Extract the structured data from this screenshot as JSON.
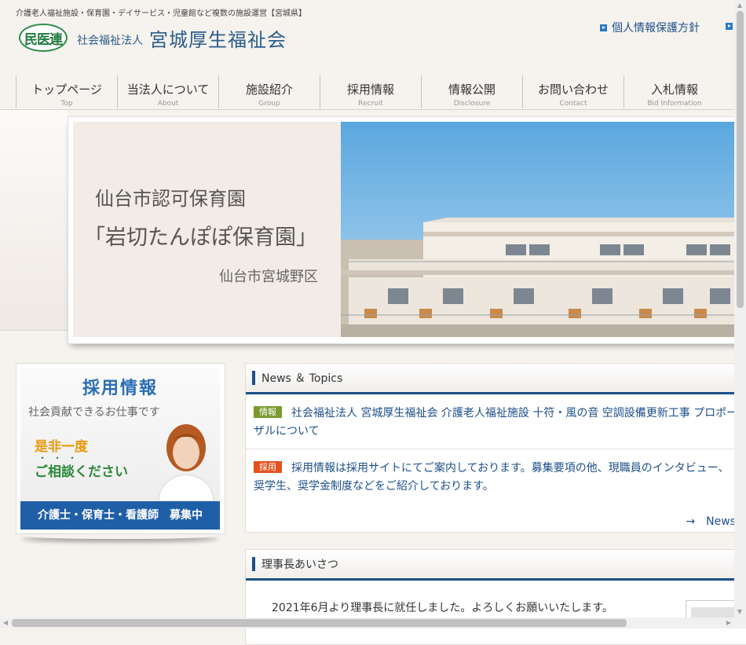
{
  "header": {
    "tagline": "介護老人福祉施設・保育園・デイサービス・児童館など複数の施設運営【宮城県】",
    "logo_mark": "民医連",
    "org_type": "社会福祉法人",
    "org_name": "宮城厚生福祉会",
    "privacy_link": "個人情報保護方針"
  },
  "nav": [
    {
      "label": "トップページ",
      "sub": "Top"
    },
    {
      "label": "当法人について",
      "sub": "About"
    },
    {
      "label": "施設紹介",
      "sub": "Group"
    },
    {
      "label": "採用情報",
      "sub": "Recruit"
    },
    {
      "label": "情報公開",
      "sub": "Disclosure"
    },
    {
      "label": "お問い合わせ",
      "sub": "Contact"
    },
    {
      "label": "入札情報",
      "sub": "Bid Information"
    }
  ],
  "hero": {
    "line1": "仙台市認可保育園",
    "line2": "「岩切たんぽぽ保育園」",
    "line3": "仙台市宮城野区"
  },
  "recruit_banner": {
    "title": "採用情報",
    "subtitle": "社会貢献できるお仕事です",
    "line1": "是非一度",
    "dots": "・・・",
    "line2": "ご相談ください",
    "banner": "介護士・保育士・看護師　募集中"
  },
  "news": {
    "title": "News ＆ Topics",
    "items": [
      {
        "badge": "情報",
        "badge_color": "#7a9a2e",
        "text": "社会福祉法人 宮城厚生福祉会 介護老人福祉施設 十符・風の音 空調設備更新工事 プロポーザルについて"
      },
      {
        "badge": "採用",
        "badge_color": "#e0531f",
        "text": "採用情報は採用サイトにてご案内しております。募集要項の他、現職員のインタビュー、奨学生、奨学金制度などをご紹介しております。"
      }
    ],
    "more": "→　News"
  },
  "greeting": {
    "title": "理事長あいさつ",
    "text": "2021年6月より理事長に就任しました。よろしくお願いいたします。"
  },
  "colors": {
    "accent": "#1d4f8a",
    "logo_green": "#1f7a3c"
  }
}
